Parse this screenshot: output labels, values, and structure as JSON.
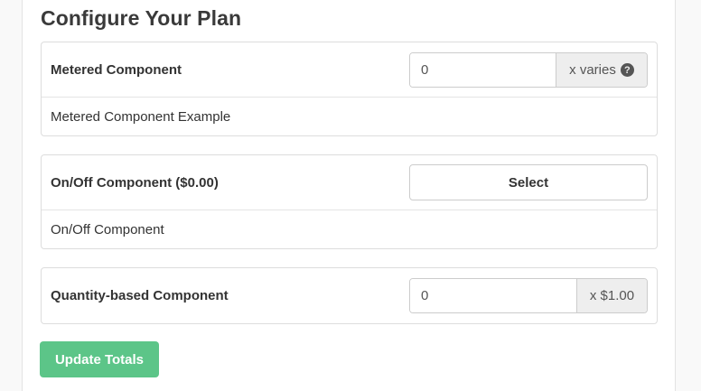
{
  "title": "Configure Your Plan",
  "components": {
    "metered": {
      "name": "Metered Component",
      "value": "0",
      "unit": "x varies",
      "help_icon": "?",
      "description": "Metered Component Example"
    },
    "onoff": {
      "name": "On/Off Component ($0.00)",
      "button_label": "Select",
      "description": "On/Off Component"
    },
    "quantity": {
      "name": "Quantity-based Component",
      "value": "0",
      "unit": "x $1.00"
    }
  },
  "update_button": "Update Totals",
  "colors": {
    "update_button": "#5cc588",
    "addon_background": "#eeeeee",
    "border": "#dddddd"
  }
}
